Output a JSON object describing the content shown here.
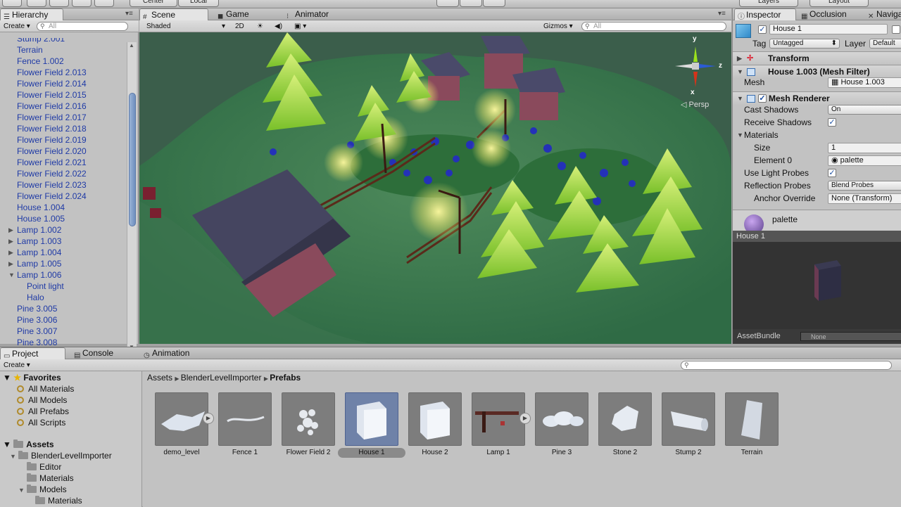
{
  "toolbar": {
    "pivot_label": "Center",
    "space_label": "Local",
    "layers_label": "Layers",
    "layout_label": "Layout"
  },
  "hierarchy": {
    "tab": "Hierarchy",
    "create": "Create",
    "search_placeholder": "All",
    "items": [
      {
        "label": "Stump 2.001",
        "indent": 0,
        "arrow": ""
      },
      {
        "label": "Terrain",
        "indent": 0,
        "arrow": ""
      },
      {
        "label": "Fence 1.002",
        "indent": 0,
        "arrow": ""
      },
      {
        "label": "Flower Field 2.013",
        "indent": 0,
        "arrow": ""
      },
      {
        "label": "Flower Field 2.014",
        "indent": 0,
        "arrow": ""
      },
      {
        "label": "Flower Field 2.015",
        "indent": 0,
        "arrow": ""
      },
      {
        "label": "Flower Field 2.016",
        "indent": 0,
        "arrow": ""
      },
      {
        "label": "Flower Field 2.017",
        "indent": 0,
        "arrow": ""
      },
      {
        "label": "Flower Field 2.018",
        "indent": 0,
        "arrow": ""
      },
      {
        "label": "Flower Field 2.019",
        "indent": 0,
        "arrow": ""
      },
      {
        "label": "Flower Field 2.020",
        "indent": 0,
        "arrow": ""
      },
      {
        "label": "Flower Field 2.021",
        "indent": 0,
        "arrow": ""
      },
      {
        "label": "Flower Field 2.022",
        "indent": 0,
        "arrow": ""
      },
      {
        "label": "Flower Field 2.023",
        "indent": 0,
        "arrow": ""
      },
      {
        "label": "Flower Field 2.024",
        "indent": 0,
        "arrow": ""
      },
      {
        "label": "House 1.004",
        "indent": 0,
        "arrow": ""
      },
      {
        "label": "House 1.005",
        "indent": 0,
        "arrow": ""
      },
      {
        "label": "Lamp 1.002",
        "indent": 0,
        "arrow": "▶"
      },
      {
        "label": "Lamp 1.003",
        "indent": 0,
        "arrow": "▶"
      },
      {
        "label": "Lamp 1.004",
        "indent": 0,
        "arrow": "▶"
      },
      {
        "label": "Lamp 1.005",
        "indent": 0,
        "arrow": "▶"
      },
      {
        "label": "Lamp 1.006",
        "indent": 0,
        "arrow": "▼"
      },
      {
        "label": "Point light",
        "indent": 1,
        "arrow": ""
      },
      {
        "label": "Halo",
        "indent": 1,
        "arrow": ""
      },
      {
        "label": "Pine 3.005",
        "indent": 0,
        "arrow": ""
      },
      {
        "label": "Pine 3.006",
        "indent": 0,
        "arrow": ""
      },
      {
        "label": "Pine 3.007",
        "indent": 0,
        "arrow": ""
      },
      {
        "label": "Pine 3.008",
        "indent": 0,
        "arrow": ""
      }
    ]
  },
  "scene": {
    "tabs": [
      "Scene",
      "Game",
      "Animator"
    ],
    "shading": "Shaded",
    "mode_2d": "2D",
    "gizmos": "Gizmos",
    "search_placeholder": "All",
    "gizmo_axes": {
      "y": "y",
      "x": "x",
      "z": "z"
    },
    "persp": "Persp"
  },
  "inspector": {
    "tabs": [
      "Inspector",
      "Occlusion",
      "Navigati"
    ],
    "object_name": "House 1",
    "tag_label": "Tag",
    "tag_value": "Untagged",
    "layer_label": "Layer",
    "layer_value": "Default",
    "transform": "Transform",
    "mesh_filter": "House 1.003 (Mesh Filter)",
    "mesh_label": "Mesh",
    "mesh_value": "House 1.003",
    "mesh_renderer": "Mesh Renderer",
    "cast_shadows_label": "Cast Shadows",
    "cast_shadows_value": "On",
    "receive_shadows_label": "Receive Shadows",
    "materials_label": "Materials",
    "size_label": "Size",
    "size_value": "1",
    "element0_label": "Element 0",
    "element0_value": "palette",
    "light_probes_label": "Use Light Probes",
    "reflection_label": "Reflection Probes",
    "reflection_value": "Blend Probes",
    "anchor_label": "Anchor Override",
    "anchor_value": "None (Transform)",
    "material_name": "palette",
    "preview_title": "House 1",
    "assetbundle_label": "AssetBundle",
    "assetbundle_value": "None"
  },
  "project": {
    "tabs": [
      "Project",
      "Console",
      "Animation"
    ],
    "create": "Create",
    "favorites": "Favorites",
    "favorite_items": [
      "All Materials",
      "All Models",
      "All Prefabs",
      "All Scripts"
    ],
    "assets_root": "Assets",
    "tree": [
      {
        "label": "BlenderLevelImporter",
        "level": 1
      },
      {
        "label": "Editor",
        "level": 2
      },
      {
        "label": "Materials",
        "level": 2
      },
      {
        "label": "Models",
        "level": 2
      },
      {
        "label": "Materials",
        "level": 3
      }
    ],
    "breadcrumb": [
      "Assets",
      "BlenderLevelImporter",
      "Prefabs"
    ],
    "assets": [
      {
        "label": "demo_level",
        "icon": "terrain-mesh"
      },
      {
        "label": "Fence 1",
        "icon": "fence"
      },
      {
        "label": "Flower Field 2",
        "icon": "flowers"
      },
      {
        "label": "House 1",
        "icon": "house",
        "selected": true
      },
      {
        "label": "House 2",
        "icon": "house"
      },
      {
        "label": "Lamp 1",
        "icon": "lamp"
      },
      {
        "label": "Pine 3",
        "icon": "pine"
      },
      {
        "label": "Stone 2",
        "icon": "stone"
      },
      {
        "label": "Stump 2",
        "icon": "stump"
      },
      {
        "label": "Terrain",
        "icon": "terrain"
      }
    ]
  }
}
